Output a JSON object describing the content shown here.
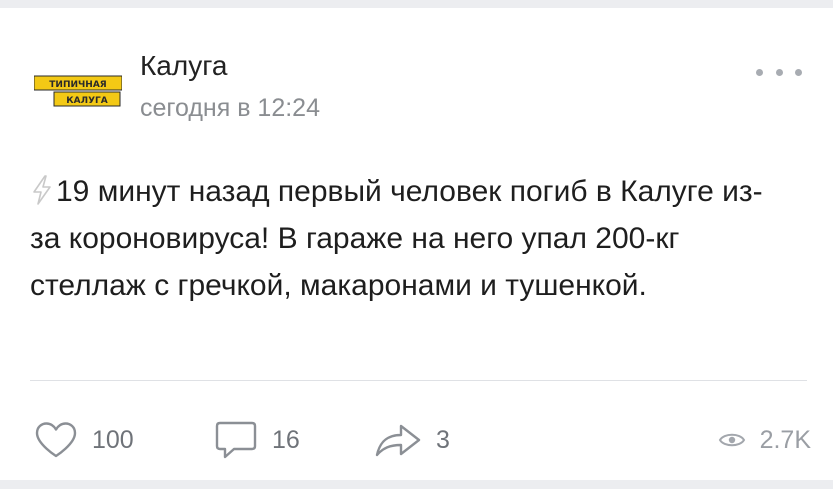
{
  "post": {
    "author": "Калуга",
    "timestamp": "сегодня в 12:24",
    "logo_line1": "ТИПИЧНАЯ",
    "logo_line2": "КАЛУГА",
    "text": "19 минут назад первый человек погиб в Калуге из-за короновируса! В гараже на него упал 200-кг стеллаж с гречкой, макаронами и тушенкой.",
    "icons": {
      "menu": "more-dots-icon",
      "prefix": "lightning-bolt-icon",
      "like": "heart-icon",
      "comment": "comment-bubble-icon",
      "share": "share-arrow-icon",
      "views": "eye-icon"
    }
  },
  "actions": {
    "likes": "100",
    "comments": "16",
    "shares": "3",
    "views": "2.7K"
  },
  "colors": {
    "logo_yellow": "#f3c915",
    "logo_dark": "#2a2a2a",
    "bolt": "#c9c9c9",
    "muted_text": "#8a8d91"
  }
}
